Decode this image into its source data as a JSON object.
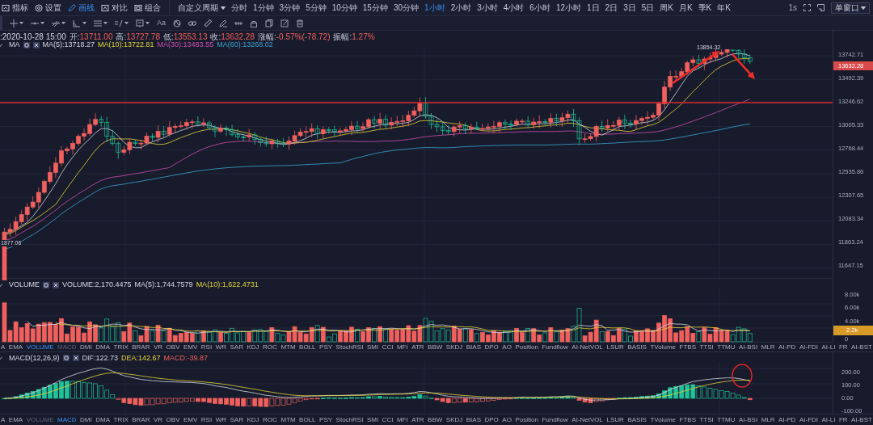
{
  "toolbar": {
    "tools": [
      {
        "kind": "indicator",
        "label": "指标",
        "selected": false
      },
      {
        "kind": "settings",
        "label": "设置",
        "selected": false
      },
      {
        "kind": "draw",
        "label": "画线",
        "selected": true
      },
      {
        "kind": "compare",
        "label": "对比",
        "selected": false
      },
      {
        "kind": "group",
        "label": "组合",
        "selected": false
      }
    ],
    "custom_period": "自定义周期",
    "periods": [
      {
        "label": "分时",
        "selected": false
      },
      {
        "label": "1分钟",
        "selected": false
      },
      {
        "label": "3分钟",
        "selected": false
      },
      {
        "label": "5分钟",
        "selected": false
      },
      {
        "label": "10分钟",
        "selected": false
      },
      {
        "label": "15分钟",
        "selected": false
      },
      {
        "label": "30分钟",
        "selected": false
      },
      {
        "label": "1小时",
        "selected": true
      },
      {
        "label": "2小时",
        "selected": false
      },
      {
        "label": "3小时",
        "selected": false
      },
      {
        "label": "4小时",
        "selected": false
      },
      {
        "label": "6小时",
        "selected": false
      },
      {
        "label": "12小时",
        "selected": false
      },
      {
        "label": "1日",
        "selected": false
      },
      {
        "label": "2日",
        "selected": false
      },
      {
        "label": "3日",
        "selected": false
      },
      {
        "label": "5日",
        "selected": false
      },
      {
        "label": "周K",
        "selected": false
      },
      {
        "label": "月K",
        "selected": false
      },
      {
        "label": "季K",
        "selected": false
      },
      {
        "label": "年K",
        "selected": false
      }
    ],
    "refresh": "1s",
    "window_mode": "单窗口"
  },
  "drawing_tools": [
    {
      "kind": "crosshair",
      "dropdown": true
    },
    {
      "kind": "line",
      "dropdown": true
    },
    {
      "kind": "parallel",
      "dropdown": true
    },
    {
      "kind": "angle",
      "dropdown": true
    },
    {
      "kind": "levels",
      "dropdown": true
    },
    {
      "kind": "fib",
      "dropdown": true
    },
    {
      "kind": "frame",
      "dropdown": true
    },
    {
      "kind": "text",
      "label": "Aa",
      "dropdown": false
    },
    {
      "kind": "pattern",
      "dropdown": false
    },
    {
      "kind": "link",
      "dropdown": false
    },
    {
      "kind": "ruler",
      "dropdown": false
    },
    {
      "kind": "pen",
      "dropdown": false
    },
    {
      "kind": "measure",
      "dropdown": false
    },
    {
      "kind": "lock",
      "dropdown": false
    },
    {
      "kind": "copy",
      "dropdown": false
    },
    {
      "kind": "edit",
      "dropdown": false
    },
    {
      "kind": "delete",
      "dropdown": false
    }
  ],
  "info": {
    "time": ":2020-10-28 15:00",
    "fields": [
      {
        "label": "开:",
        "value": "13711.00"
      },
      {
        "label": "高:",
        "value": "13727.78"
      },
      {
        "label": "低:",
        "value": "13553.13"
      },
      {
        "label": "收:",
        "value": "13632.28"
      },
      {
        "label": "涨幅:",
        "value": "-0.57%(-78.72)"
      },
      {
        "label": "振幅:",
        "value": "1.27%"
      }
    ]
  },
  "price_pane": {
    "indicator": "MA",
    "legend": [
      {
        "text": "MA(5):13718.27"
      },
      {
        "text": "MA(10):13722.81"
      },
      {
        "text": "MA(30):13483.55"
      },
      {
        "text": "MA(60):13268.02"
      }
    ],
    "axis": [
      "13742.71",
      "13492.39",
      "13246.62",
      "13005.33",
      "12768.44",
      "12535.86",
      "12307.65",
      "12083.34",
      "11863.24",
      "11647.15"
    ],
    "current_price": "13632.28",
    "high_label": "13854.32",
    "low_label": "1877.06"
  },
  "volume_pane": {
    "indicator": "VOLUME",
    "legend": [
      {
        "text": "VOLUME:2,170.4475"
      },
      {
        "text": "MA(5):1,744.7579"
      },
      {
        "text": "MA(10):1,622.4731"
      }
    ],
    "axis": [
      "8.00k",
      "6.00k",
      "4.00k",
      "0"
    ],
    "current_value": "2.2k"
  },
  "volume_tabs": [
    {
      "label": "A",
      "selected": false,
      "dimmed": false
    },
    {
      "label": "EMA",
      "selected": false,
      "dimmed": false
    },
    {
      "label": "VOLUME",
      "selected": true,
      "dimmed": false
    },
    {
      "label": "MACD",
      "selected": false,
      "dimmed": true
    },
    {
      "label": "DMI",
      "selected": false,
      "dimmed": false
    },
    {
      "label": "DMA",
      "selected": false,
      "dimmed": false
    },
    {
      "label": "TRIX",
      "selected": false,
      "dimmed": false
    },
    {
      "label": "BRAR",
      "selected": false,
      "dimmed": false
    },
    {
      "label": "VR",
      "selected": false,
      "dimmed": false
    },
    {
      "label": "OBV",
      "selected": false,
      "dimmed": false
    },
    {
      "label": "EMV",
      "selected": false,
      "dimmed": false
    },
    {
      "label": "RSI",
      "selected": false,
      "dimmed": false
    },
    {
      "label": "WR",
      "selected": false,
      "dimmed": false
    },
    {
      "label": "SAR",
      "selected": false,
      "dimmed": false
    },
    {
      "label": "KDJ",
      "selected": false,
      "dimmed": false
    },
    {
      "label": "ROC",
      "selected": false,
      "dimmed": false
    },
    {
      "label": "MTM",
      "selected": false,
      "dimmed": false
    },
    {
      "label": "BOLL",
      "selected": false,
      "dimmed": false
    },
    {
      "label": "PSY",
      "selected": false,
      "dimmed": false
    },
    {
      "label": "StochRSI",
      "selected": false,
      "dimmed": false
    },
    {
      "label": "SMI",
      "selected": false,
      "dimmed": false
    },
    {
      "label": "CCI",
      "selected": false,
      "dimmed": false
    },
    {
      "label": "MFI",
      "selected": false,
      "dimmed": false
    },
    {
      "label": "ATR",
      "selected": false,
      "dimmed": false
    },
    {
      "label": "BBW",
      "selected": false,
      "dimmed": false
    },
    {
      "label": "SKDJ",
      "selected": false,
      "dimmed": false
    },
    {
      "label": "BIAS",
      "selected": false,
      "dimmed": false
    },
    {
      "label": "DPO",
      "selected": false,
      "dimmed": false
    },
    {
      "label": "AO",
      "selected": false,
      "dimmed": false
    },
    {
      "label": "Position",
      "selected": false,
      "dimmed": false
    },
    {
      "label": "Fundflow",
      "selected": false,
      "dimmed": false
    },
    {
      "label": "AI-NetVOL",
      "selected": false,
      "dimmed": false
    },
    {
      "label": "LSUR",
      "selected": false,
      "dimmed": false
    },
    {
      "label": "BASIS",
      "selected": false,
      "dimmed": false
    },
    {
      "label": "TVolume",
      "selected": false,
      "dimmed": false
    },
    {
      "label": "FTBS",
      "selected": false,
      "dimmed": false
    },
    {
      "label": "TTSI",
      "selected": false,
      "dimmed": false
    },
    {
      "label": "TTMU",
      "selected": false,
      "dimmed": false
    },
    {
      "label": "AI-BSI",
      "selected": false,
      "dimmed": false
    },
    {
      "label": "MLR",
      "selected": false,
      "dimmed": false
    },
    {
      "label": "AI-PD",
      "selected": false,
      "dimmed": false
    },
    {
      "label": "AI-FDI",
      "selected": false,
      "dimmed": false
    },
    {
      "label": "AI-LI",
      "selected": false,
      "dimmed": false
    },
    {
      "label": "FR",
      "selected": false,
      "dimmed": false
    },
    {
      "label": "AI-BST",
      "selected": false,
      "dimmed": false
    }
  ],
  "macd_pane": {
    "indicator": "MACD(12,26,9)",
    "legend": [
      {
        "text": "DIF:122.73"
      },
      {
        "text": "DEA:142.67"
      },
      {
        "text": "MACD:-39.87"
      }
    ],
    "axis": [
      "200.00",
      "100.00",
      "0.00",
      "-100.00"
    ]
  },
  "macd_tabs": [
    {
      "label": "A",
      "selected": false,
      "dimmed": false
    },
    {
      "label": "EMA",
      "selected": false,
      "dimmed": false
    },
    {
      "label": "VOLUME",
      "selected": false,
      "dimmed": true
    },
    {
      "label": "MACD",
      "selected": true,
      "dimmed": false
    },
    {
      "label": "DMI",
      "selected": false,
      "dimmed": false
    },
    {
      "label": "DMA",
      "selected": false,
      "dimmed": false
    },
    {
      "label": "TRIX",
      "selected": false,
      "dimmed": false
    },
    {
      "label": "BRAR",
      "selected": false,
      "dimmed": false
    },
    {
      "label": "VR",
      "selected": false,
      "dimmed": false
    },
    {
      "label": "OBV",
      "selected": false,
      "dimmed": false
    },
    {
      "label": "EMV",
      "selected": false,
      "dimmed": false
    },
    {
      "label": "RSI",
      "selected": false,
      "dimmed": false
    },
    {
      "label": "WR",
      "selected": false,
      "dimmed": false
    },
    {
      "label": "SAR",
      "selected": false,
      "dimmed": false
    },
    {
      "label": "KDJ",
      "selected": false,
      "dimmed": false
    },
    {
      "label": "ROC",
      "selected": false,
      "dimmed": false
    },
    {
      "label": "MTM",
      "selected": false,
      "dimmed": false
    },
    {
      "label": "BOLL",
      "selected": false,
      "dimmed": false
    },
    {
      "label": "PSY",
      "selected": false,
      "dimmed": false
    },
    {
      "label": "StochRSI",
      "selected": false,
      "dimmed": false
    },
    {
      "label": "SMI",
      "selected": false,
      "dimmed": false
    },
    {
      "label": "CCI",
      "selected": false,
      "dimmed": false
    },
    {
      "label": "MFI",
      "selected": false,
      "dimmed": false
    },
    {
      "label": "ATR",
      "selected": false,
      "dimmed": false
    },
    {
      "label": "BBW",
      "selected": false,
      "dimmed": false
    },
    {
      "label": "SKDJ",
      "selected": false,
      "dimmed": false
    },
    {
      "label": "BIAS",
      "selected": false,
      "dimmed": false
    },
    {
      "label": "DPO",
      "selected": false,
      "dimmed": false
    },
    {
      "label": "AO",
      "selected": false,
      "dimmed": false
    },
    {
      "label": "Position",
      "selected": false,
      "dimmed": false
    },
    {
      "label": "Fundflow",
      "selected": false,
      "dimmed": false
    },
    {
      "label": "AI-NetVOL",
      "selected": false,
      "dimmed": false
    },
    {
      "label": "LSUR",
      "selected": false,
      "dimmed": false
    },
    {
      "label": "BASIS",
      "selected": false,
      "dimmed": false
    },
    {
      "label": "TVolume",
      "selected": false,
      "dimmed": false
    },
    {
      "label": "FTBS",
      "selected": false,
      "dimmed": false
    },
    {
      "label": "TTSI",
      "selected": false,
      "dimmed": false
    },
    {
      "label": "TTMU",
      "selected": false,
      "dimmed": false
    },
    {
      "label": "AI-BSI",
      "selected": false,
      "dimmed": false
    },
    {
      "label": "MLR",
      "selected": false,
      "dimmed": false
    },
    {
      "label": "AI-PD",
      "selected": false,
      "dimmed": false
    },
    {
      "label": "AI-FDI",
      "selected": false,
      "dimmed": false
    },
    {
      "label": "AI-LI",
      "selected": false,
      "dimmed": false
    },
    {
      "label": "FR",
      "selected": false,
      "dimmed": false
    },
    {
      "label": "AI-BST",
      "selected": false,
      "dimmed": false
    }
  ]
}
